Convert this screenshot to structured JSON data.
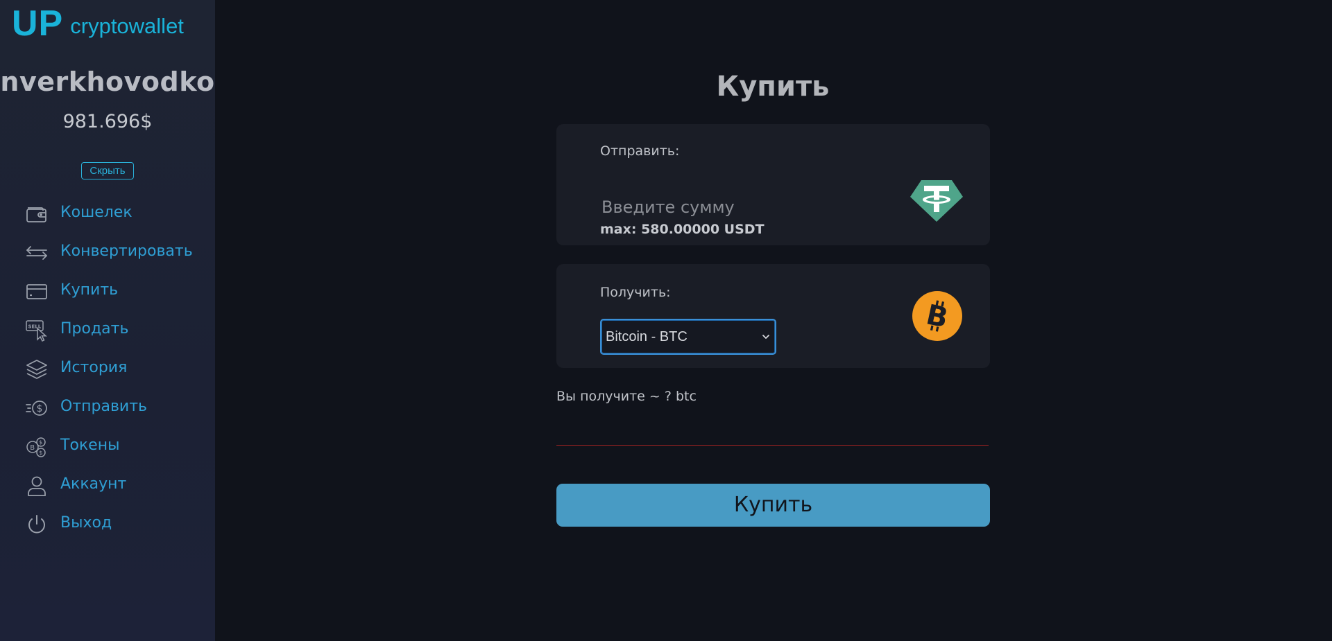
{
  "sidebar": {
    "logo_up": "UP",
    "logo_text": "cryptowallet",
    "username": "nverkhovodko",
    "balance": "981.696$",
    "hide_label": "Скрыть",
    "items": [
      {
        "label": "Кошелек",
        "icon": "wallet-icon"
      },
      {
        "label": "Конвертировать",
        "icon": "convert-arrows-icon"
      },
      {
        "label": "Купить",
        "icon": "credit-card-icon"
      },
      {
        "label": "Продать",
        "icon": "sell-click-icon"
      },
      {
        "label": "История",
        "icon": "layers-icon"
      },
      {
        "label": "Отправить",
        "icon": "send-dollar-icon"
      },
      {
        "label": "Токены",
        "icon": "tokens-coins-icon"
      },
      {
        "label": "Аккаунт",
        "icon": "user-icon"
      },
      {
        "label": "Выход",
        "icon": "power-icon"
      }
    ],
    "accent_color": "#2f9fd4",
    "logo_color": "#1ab3d9"
  },
  "main": {
    "title": "Купить",
    "send": {
      "label": "Отправить:",
      "placeholder": "Введите сумму",
      "max_text": "max: 580.00000 USDT",
      "icon": "tether-usdt-icon"
    },
    "receive": {
      "label": "Получить:",
      "selected": "Bitcoin - BTC",
      "icon": "bitcoin-icon"
    },
    "you_get": "Вы получите ~ ? btc",
    "buy_label": "Купить",
    "buy_color": "#489bc4"
  }
}
